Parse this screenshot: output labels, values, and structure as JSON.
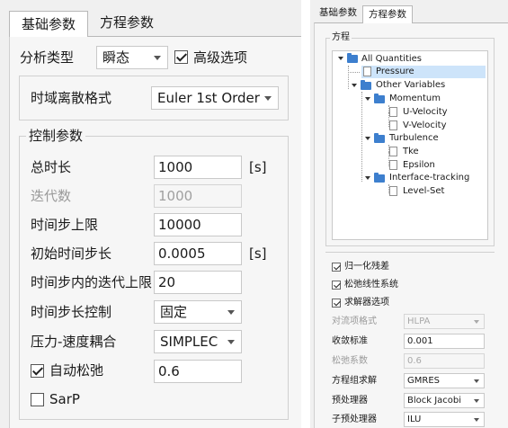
{
  "left": {
    "tabs": [
      {
        "label": "基础参数",
        "active": true
      },
      {
        "label": "方程参数",
        "active": false
      }
    ],
    "analysis_type_label": "分析类型",
    "analysis_type_value": "瞬态",
    "advanced_options_label": "高级选项",
    "advanced_options_checked": true,
    "time_discretization_label": "时域离散格式",
    "time_discretization_value": "Euler 1st Order",
    "control_group_title": "控制参数",
    "total_time_label": "总时长",
    "total_time_value": "1000",
    "total_time_unit": "[s]",
    "iterations_label": "迭代数",
    "iterations_value": "1000",
    "time_step_limit_label": "时间步上限",
    "time_step_limit_value": "10000",
    "initial_step_label": "初始时间步长",
    "initial_step_value": "0.0005",
    "initial_step_unit": "[s]",
    "inner_iter_label": "时间步内的迭代上限",
    "inner_iter_value": "20",
    "step_control_label": "时间步长控制",
    "step_control_value": "固定",
    "pv_coupling_label": "压力-速度耦合",
    "pv_coupling_value": "SIMPLEC",
    "auto_relax_label": "自动松弛",
    "auto_relax_checked": true,
    "auto_relax_value": "0.6",
    "sarp_label": "SarP",
    "sarp_checked": false
  },
  "right": {
    "tabs": [
      {
        "label": "基础参数",
        "active": false
      },
      {
        "label": "方程参数",
        "active": true
      }
    ],
    "equation_group_title": "方程",
    "tree": {
      "root": "All Quantities",
      "pressure": "Pressure",
      "other_variables": "Other Variables",
      "momentum": "Momentum",
      "u_velocity": "U-Velocity",
      "v_velocity": "V-Velocity",
      "turbulence": "Turbulence",
      "tke": "Tke",
      "epsilon": "Epsilon",
      "interface_tracking": "Interface-tracking",
      "level_set": "Level-Set",
      "selected": "Pressure"
    },
    "normalize_residual_label": "归一化残差",
    "normalize_residual_checked": true,
    "relax_linear_label": "松弛线性系统",
    "relax_linear_checked": true,
    "solver_options_label": "求解器选项",
    "solver_options_checked": true,
    "convection_scheme_label": "对流项格式",
    "convection_scheme_value": "HLPA",
    "convergence_label": "收敛标准",
    "convergence_value": "0.001",
    "relax_factor_label": "松弛系数",
    "relax_factor_value": "0.6",
    "equation_solver_label": "方程组求解",
    "equation_solver_value": "GMRES",
    "preconditioner_label": "预处理器",
    "preconditioner_value": "Block Jacobi",
    "sub_preconditioner_label": "子预处理器",
    "sub_preconditioner_value": "ILU"
  },
  "colors": {
    "panel_bg": "#f0f0f0",
    "selection_bg": "#cde4fa",
    "folder_blue": "#3d7fce"
  }
}
